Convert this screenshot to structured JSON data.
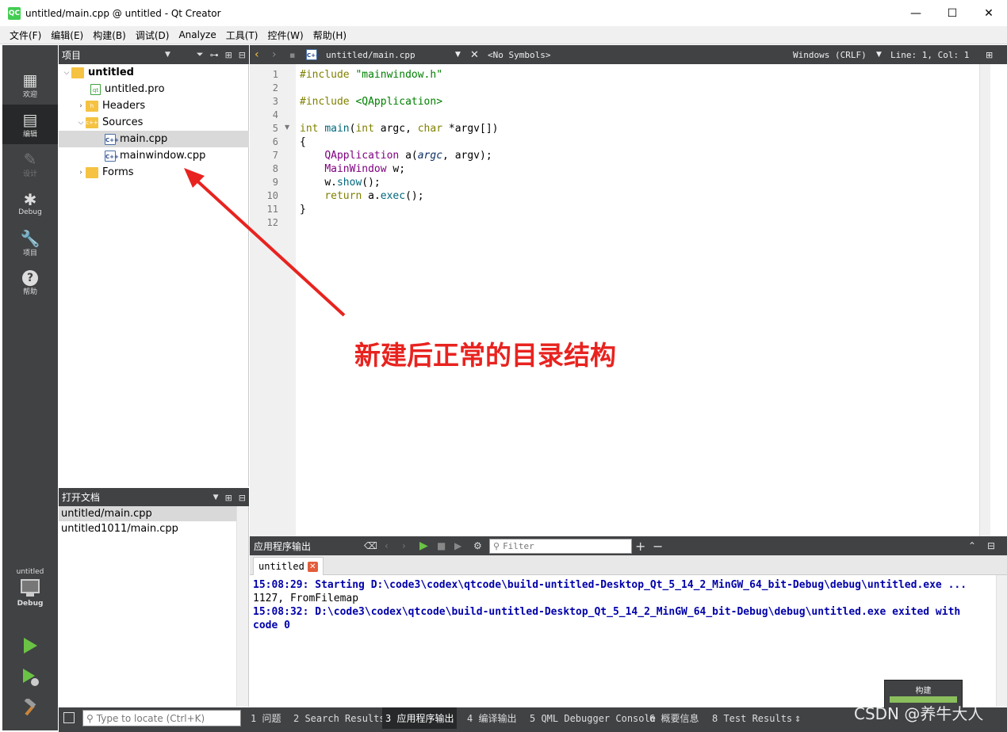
{
  "window": {
    "title": "untitled/main.cpp @ untitled - Qt Creator",
    "icon_text": "QC",
    "minimize": "—",
    "maximize": "☐",
    "close": "✕"
  },
  "menubar": [
    "文件(F)",
    "编辑(E)",
    "构建(B)",
    "调试(D)",
    "Analyze",
    "工具(T)",
    "控件(W)",
    "帮助(H)"
  ],
  "modes": [
    {
      "label": "欢迎",
      "icon": "grid-icon",
      "glyph": "▦"
    },
    {
      "label": "编辑",
      "icon": "edit-doc-icon",
      "glyph": "▤"
    },
    {
      "label": "设计",
      "icon": "pencil-icon",
      "glyph": "✎"
    },
    {
      "label": "Debug",
      "icon": "bug-icon",
      "glyph": "✱"
    },
    {
      "label": "项目",
      "icon": "wrench-icon",
      "glyph": "🔧"
    },
    {
      "label": "帮助",
      "icon": "help-icon",
      "glyph": "?"
    }
  ],
  "target": {
    "project": "untitled",
    "config": "Debug"
  },
  "project_panel": {
    "title": "项目",
    "tree": [
      {
        "label": "untitled",
        "level": 0,
        "expanded": true,
        "kind": "project",
        "bold": true
      },
      {
        "label": "untitled.pro",
        "level": 1,
        "kind": "pro"
      },
      {
        "label": "Headers",
        "level": 1,
        "expanded": false,
        "kind": "folder"
      },
      {
        "label": "Sources",
        "level": 1,
        "expanded": true,
        "kind": "folder"
      },
      {
        "label": "main.cpp",
        "level": 2,
        "kind": "cpp",
        "selected": true
      },
      {
        "label": "mainwindow.cpp",
        "level": 2,
        "kind": "cpp"
      },
      {
        "label": "Forms",
        "level": 1,
        "expanded": false,
        "kind": "folder"
      }
    ]
  },
  "open_docs": {
    "title": "打开文档",
    "items": [
      "untitled/main.cpp",
      "untitled1011/main.cpp"
    ]
  },
  "editor": {
    "file": "untitled/main.cpp",
    "symbols": "<No Symbols>",
    "line_ending": "Windows (CRLF)",
    "cursor": "Line: 1, Col: 1",
    "line_numbers": [
      "1",
      "2",
      "3",
      "4",
      "5",
      "6",
      "7",
      "8",
      "9",
      "10",
      "11",
      "12"
    ]
  },
  "annotation": {
    "text": "新建后正常的目录结构",
    "color": "#e8231f"
  },
  "output_pane": {
    "title": "应用程序输出",
    "filter_placeholder": "Filter",
    "tab": "untitled",
    "lines": [
      {
        "text": "15:08:29: Starting D:\\code3\\codex\\qtcode\\build-untitled-Desktop_Qt_5_14_2_MinGW_64_bit-Debug\\debug\\untitled.exe ...",
        "style": "blue"
      },
      {
        "text": "1127, FromFilemap",
        "style": "plain"
      },
      {
        "text": "15:08:32: D:\\code3\\codex\\qtcode\\build-untitled-Desktop_Qt_5_14_2_MinGW_64_bit-Debug\\debug\\untitled.exe exited with",
        "style": "blue"
      },
      {
        "text": "code 0",
        "style": "blue"
      }
    ]
  },
  "statusbar": {
    "locator_placeholder": "Type to locate (Ctrl+K)",
    "tabs": [
      "1 问题",
      "2 Search Results",
      "3 应用程序输出",
      "4 编译输出",
      "5 QML Debugger Console",
      "6 概要信息",
      "8 Test Results"
    ]
  },
  "build_widget": {
    "label": "构建",
    "progress": 1.0
  },
  "watermark": "CSDN @养牛大人",
  "colors": {
    "accent_green": "#41cd52",
    "panel_dark": "#404244",
    "annotation_red": "#e8231f"
  }
}
